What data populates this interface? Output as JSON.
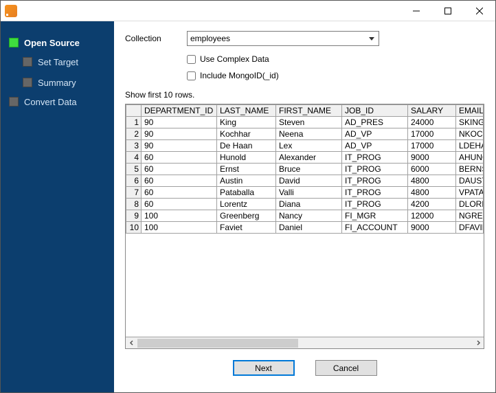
{
  "sidebar": {
    "steps": [
      {
        "label": "Open Source",
        "active": true
      },
      {
        "label": "Set Target",
        "active": false
      },
      {
        "label": "Summary",
        "active": false
      },
      {
        "label": "Convert Data",
        "active": false
      }
    ]
  },
  "form": {
    "collection_label": "Collection",
    "collection_value": "employees",
    "use_complex_label": "Use Complex Data",
    "include_mongoid_label": "Include MongoID(_id)"
  },
  "caption": "Show first 10 rows.",
  "table": {
    "columns": [
      "DEPARTMENT_ID",
      "LAST_NAME",
      "FIRST_NAME",
      "JOB_ID",
      "SALARY",
      "EMAIL"
    ],
    "rows": [
      [
        "90",
        "King",
        "Steven",
        "AD_PRES",
        "24000",
        "SKING"
      ],
      [
        "90",
        "Kochhar",
        "Neena",
        "AD_VP",
        "17000",
        "NKOCHHAR"
      ],
      [
        "90",
        "De Haan",
        "Lex",
        "AD_VP",
        "17000",
        "LDEHAAN"
      ],
      [
        "60",
        "Hunold",
        "Alexander",
        "IT_PROG",
        "9000",
        "AHUNOLD"
      ],
      [
        "60",
        "Ernst",
        "Bruce",
        "IT_PROG",
        "6000",
        "BERNST"
      ],
      [
        "60",
        "Austin",
        "David",
        "IT_PROG",
        "4800",
        "DAUSTIN"
      ],
      [
        "60",
        "Pataballa",
        "Valli",
        "IT_PROG",
        "4800",
        "VPATABAL"
      ],
      [
        "60",
        "Lorentz",
        "Diana",
        "IT_PROG",
        "4200",
        "DLORENTZ"
      ],
      [
        "100",
        "Greenberg",
        "Nancy",
        "FI_MGR",
        "12000",
        "NGREENBE"
      ],
      [
        "100",
        "Faviet",
        "Daniel",
        "FI_ACCOUNT",
        "9000",
        "DFAVIET"
      ]
    ]
  },
  "buttons": {
    "next": "Next",
    "cancel": "Cancel"
  }
}
